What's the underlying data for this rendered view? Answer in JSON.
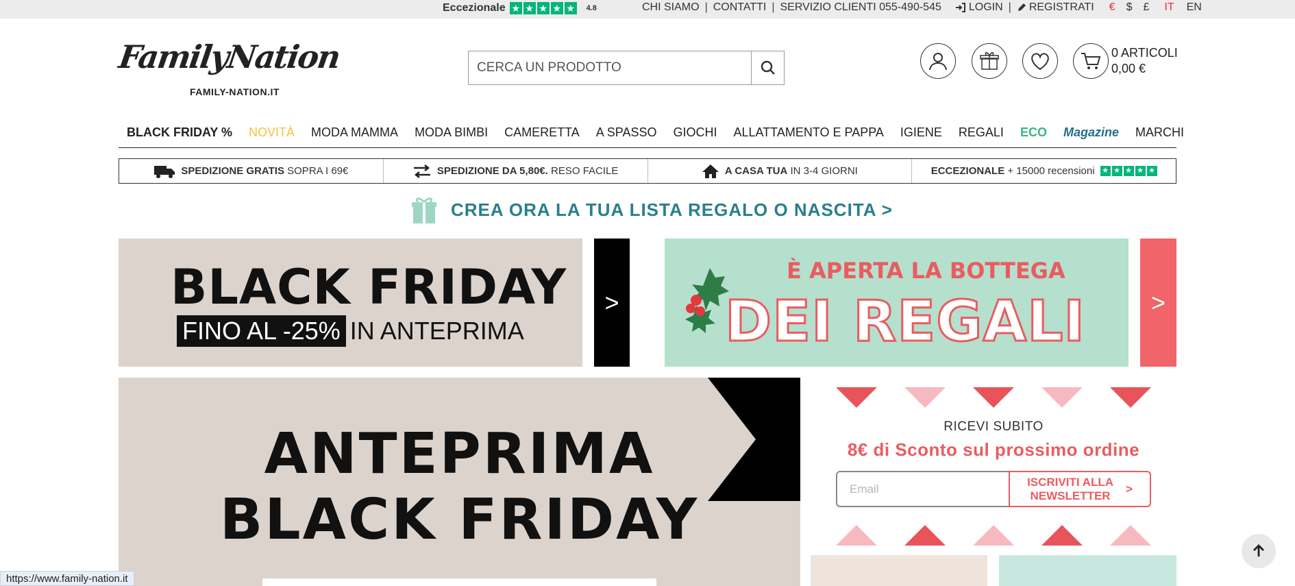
{
  "topbar": {
    "trustpilot_label": "Eccezionale",
    "trustpilot_score": "4.8",
    "links": [
      "CHI SIAMO",
      "CONTATTI",
      "SERVIZIO CLIENTI 055-490-545"
    ],
    "login": "LOGIN",
    "register": "REGISTRATI",
    "currencies": [
      "€",
      "$",
      "£"
    ],
    "languages": [
      "IT",
      "EN"
    ]
  },
  "logo": {
    "script": "FamilyNation",
    "domain": "FAMILY-NATION.IT"
  },
  "search": {
    "placeholder": "CERCA UN PRODOTTO"
  },
  "cart": {
    "items": "0 ARTICOLI",
    "total": "0,00 €"
  },
  "nav": [
    "BLACK FRIDAY %",
    "NOVITÀ",
    "MODA MAMMA",
    "MODA BIMBI",
    "CAMERETTA",
    "A SPASSO",
    "GIOCHI",
    "ALLATTAMENTO E PAPPA",
    "IGIENE",
    "REGALI",
    "ECO",
    "Magazine",
    "MARCHI"
  ],
  "usp": [
    {
      "bold": "SPEDIZIONE GRATIS",
      "rest": " SOPRA I 69€"
    },
    {
      "bold": "SPEDIZIONE DA 5,80€.",
      "rest": " RESO FACILE"
    },
    {
      "bold": "A CASA TUA",
      "rest": " IN 3-4 GIORNI"
    },
    {
      "bold": "ECCEZIONALE",
      "rest": " + 15000 recensioni"
    }
  ],
  "gift_banner": "CREA ORA LA TUA LISTA REGALO O NASCITA >",
  "banner_black_friday": {
    "title": "BLACK FRIDAY",
    "highlight": "FINO AL -25%",
    "rest": "IN ANTEPRIMA",
    "arrow": ">"
  },
  "banner_regali": {
    "top": "È APERTA LA BOTTEGA",
    "big": "DEI REGALI",
    "arrow": ">"
  },
  "hero": {
    "line1": "ANTEPRIMA",
    "line2": "BLACK FRIDAY"
  },
  "newsletter": {
    "label": "RICEVI SUBITO",
    "offer": "8€ di Sconto sul prossimo ordine",
    "email_placeholder": "Email",
    "button_line1": "ISCRIVITI ALLA",
    "button_line2": "NEWSLETTER",
    "button_arrow": ">"
  },
  "status_url": "https://www.family-nation.it",
  "colors": {
    "accent": "#e95c60",
    "trustpilot": "#00b67a",
    "eco": "#3bb583",
    "novita": "#f5c242"
  }
}
